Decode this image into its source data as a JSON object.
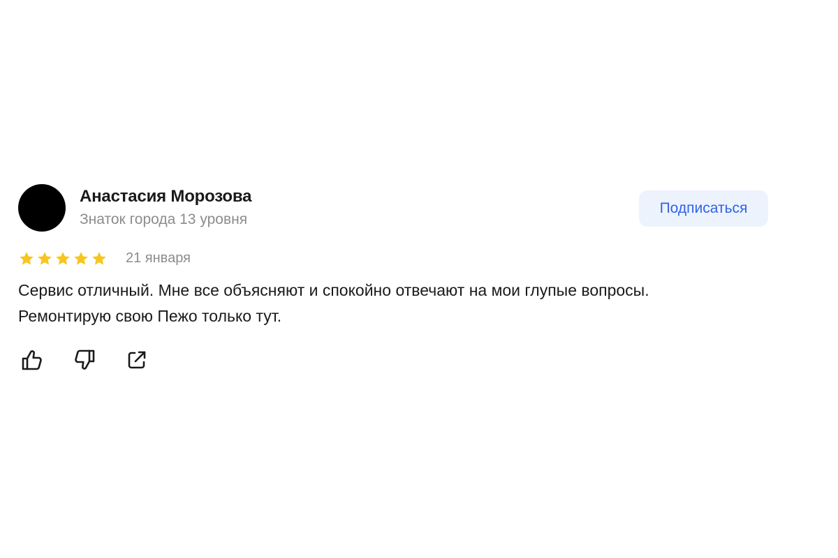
{
  "review": {
    "author": {
      "name": "Анастасия Морозова",
      "level": "Знаток города 13 уровня"
    },
    "subscribe_label": "Подписаться",
    "rating": 5,
    "rating_max": 5,
    "date": "21 января",
    "text_lines": [
      "Сервис отличный. Мне все объясняют и спокойно отвечают на мои глупые вопросы.",
      "Ремонтирую свою Пежо только тут."
    ],
    "actions": [
      "thumbs-up-icon",
      "thumbs-down-icon",
      "share-icon"
    ]
  },
  "colors": {
    "star": "#f7c51d",
    "accent": "#2f62e6",
    "button_bg": "#edf3fd",
    "muted_text": "#8c8c8c",
    "text": "#1a1a1a"
  }
}
